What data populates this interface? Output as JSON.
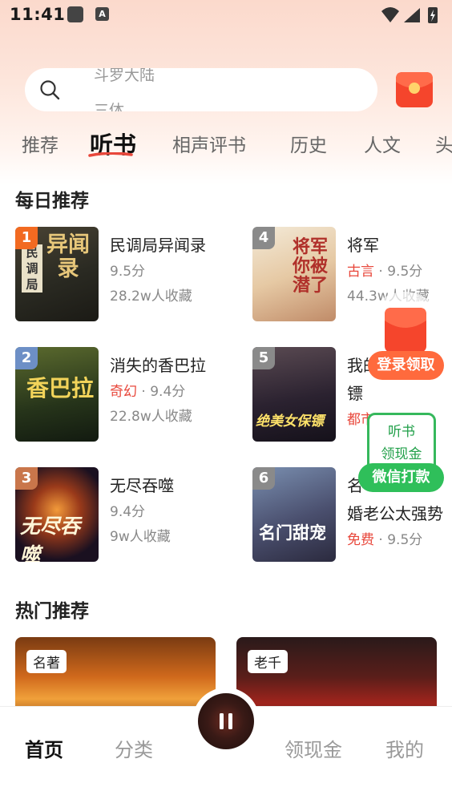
{
  "status_bar": {
    "time": "11:41",
    "notification_badge": "A"
  },
  "search": {
    "line1": "斗罗大陆",
    "line2": "三体"
  },
  "tabs": [
    {
      "label": "推荐"
    },
    {
      "label": "听书"
    },
    {
      "label": "相声评书"
    },
    {
      "label": "历史"
    },
    {
      "label": "人文"
    },
    {
      "label": "头"
    }
  ],
  "daily": {
    "title": "每日推荐",
    "books": [
      {
        "rank": "1",
        "title": "民调局异闻录",
        "genre": "",
        "score": "9.5分",
        "favorites": "28.2w人收藏",
        "cover_text": "民调局异闻录"
      },
      {
        "rank": "2",
        "title": "消失的香巴拉",
        "genre": "奇幻",
        "score": "9.4分",
        "favorites": "22.8w人收藏",
        "cover_text": "香巴拉"
      },
      {
        "rank": "3",
        "title": "无尽吞噬",
        "genre": "",
        "score": "9.4分",
        "favorites": "9w人收藏",
        "cover_text": "无尽吞噬"
      },
      {
        "rank": "4",
        "title": "将军",
        "genre": "古言",
        "score": "9.5分",
        "favorites": "44.3w人收藏",
        "cover_text": "将军你被潜了"
      },
      {
        "rank": "5",
        "title_line1": "我的",
        "title_line2": "镖",
        "genre": "都市",
        "cover_text": "绝美女保镖"
      },
      {
        "rank": "6",
        "title_line1": "名",
        "title_line2": "婚老公太强势",
        "genre": "免费",
        "score": "9.5分",
        "cover_text": "名门甜宠"
      }
    ]
  },
  "hot": {
    "title": "热门推荐",
    "cards": [
      {
        "tag": "名著"
      },
      {
        "tag": "老千"
      }
    ]
  },
  "floating": {
    "login_label": "登录领取",
    "cash_line1": "听书",
    "cash_line2": "领现金",
    "cash_button": "微信打款"
  },
  "bottom_nav": {
    "home": "首页",
    "category": "分类",
    "cash": "领现金",
    "mine": "我的"
  },
  "colors": {
    "accent": "#e8473b",
    "green": "#2fbf5a",
    "orange": "#ff6a3d"
  }
}
